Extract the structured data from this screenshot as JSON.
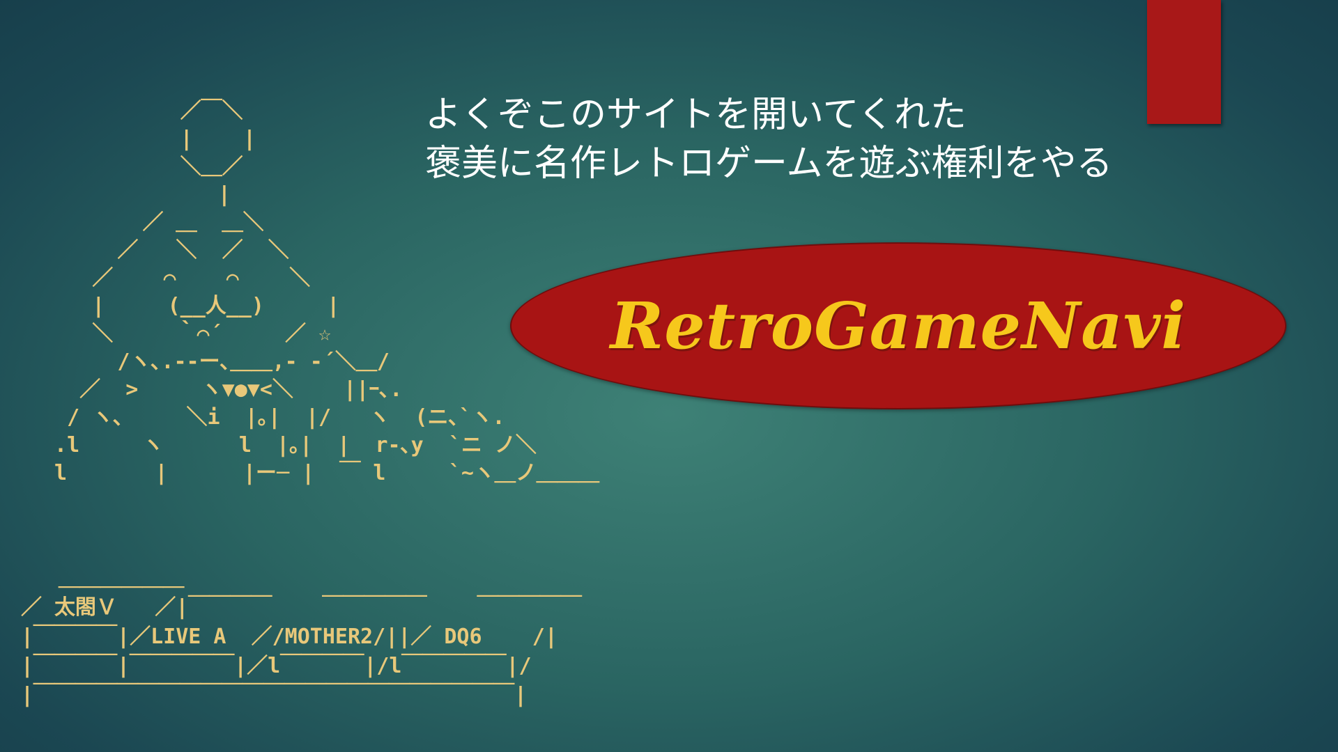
{
  "colors": {
    "tab": "#a81818",
    "welcome_text": "#ffffff",
    "logo_fill": "#a81414",
    "logo_text": "#f6c81c",
    "ascii_art": "#e8c87a"
  },
  "welcome": {
    "line1": "よくぞこのサイトを開いてくれた",
    "line2": "褒美に名作レトロゲームを遊ぶ権利をやる"
  },
  "logo": {
    "text": "RetroGameNavi"
  },
  "ascii_art": {
    "figure": "           ／￣＼\n           |    |\n           ＼＿／\n              |\n        ／ ＿  ＿＼\n      ／   ＼  ／  ＼\n    ／    ⌒    ⌒    ＼\n    |     (__人__)     |\n    ＼     ｀⌒´     ／ ☆\n      /ヽ､.--ー､＿＿,- -´＼＿/\n   ／  >     ヽ▼●▼<＼    ||ｰ､.\n  / ヽ､     ＼i  |｡|  |/   ヽ  (ニ､`ヽ.\n .l     ヽ      l  |｡|  |  r-､y  `ニ ノ＼\n l       |      |ー─ |  ￣ l     `~ヽ＿ノ＿＿＿",
    "shelf": "   ＿＿＿＿＿＿\n／ 太閤Ｖ   ／|￣￣￣￣    ￣￣￣￣￣    ￣￣￣￣￣\n|￣￣￣￣|／LIVE A  ／/MOTHER2/||／ DQ6    /|\n|￣￣￣￣|￣￣￣￣￣|／l￣￣￣￣|/l￣￣￣￣￣|/\n|￣￣￣￣￣￣￣￣￣￣￣￣￣￣￣￣￣￣￣￣￣￣￣|"
  }
}
